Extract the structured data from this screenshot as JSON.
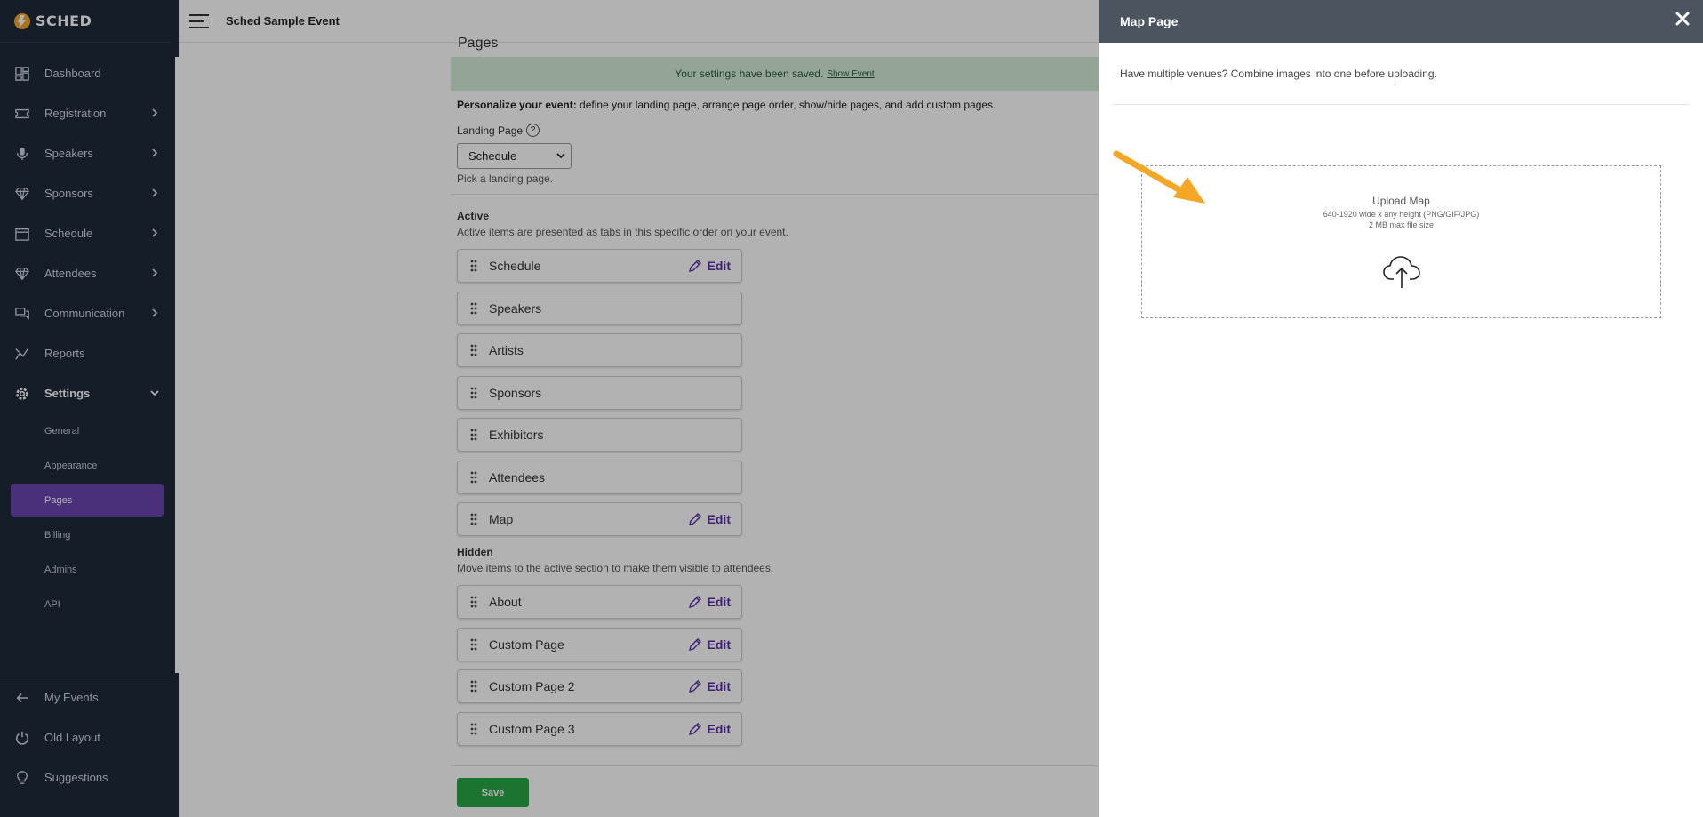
{
  "app": {
    "logo_text": "SCHED",
    "event_title": "Sched Sample Event"
  },
  "sidebar": {
    "items": [
      {
        "label": "Dashboard",
        "icon": "dashboard-icon",
        "has_chevron": false
      },
      {
        "label": "Registration",
        "icon": "ticket-icon",
        "has_chevron": true
      },
      {
        "label": "Speakers",
        "icon": "microphone-icon",
        "has_chevron": true
      },
      {
        "label": "Sponsors",
        "icon": "diamond-icon",
        "has_chevron": true
      },
      {
        "label": "Schedule",
        "icon": "calendar-icon",
        "has_chevron": true
      },
      {
        "label": "Attendees",
        "icon": "diamond-icon",
        "has_chevron": true
      },
      {
        "label": "Communication",
        "icon": "chat-icon",
        "has_chevron": true
      },
      {
        "label": "Reports",
        "icon": "chart-icon",
        "has_chevron": false
      },
      {
        "label": "Settings",
        "icon": "gear-icon",
        "has_chevron": true
      }
    ],
    "settings_sub": [
      "General",
      "Appearance",
      "Pages",
      "Billing",
      "Admins",
      "API"
    ],
    "bottom": [
      {
        "label": "My Events",
        "icon": "arrow-left-icon"
      },
      {
        "label": "Old Layout",
        "icon": "power-icon"
      },
      {
        "label": "Suggestions",
        "icon": "lightbulb-icon"
      }
    ]
  },
  "main": {
    "heading": "Pages",
    "alert": {
      "text": "Your settings have been saved.",
      "link": "Show Event"
    },
    "intro_bold": "Personalize your event:",
    "intro_text": " define your landing page, arrange page order, show/hide pages, and add custom pages.",
    "landing_label": "Landing Page",
    "landing_help": "?",
    "landing_value": "Schedule",
    "landing_hint": "Pick a landing page.",
    "active_title": "Active",
    "active_desc": "Active items are presented as tabs in this specific order on your event.",
    "active_items": [
      {
        "name": "Schedule",
        "editable": true
      },
      {
        "name": "Speakers",
        "editable": false
      },
      {
        "name": "Artists",
        "editable": false
      },
      {
        "name": "Sponsors",
        "editable": false
      },
      {
        "name": "Exhibitors",
        "editable": false
      },
      {
        "name": "Attendees",
        "editable": false
      },
      {
        "name": "Map",
        "editable": true
      }
    ],
    "hidden_title": "Hidden",
    "hidden_desc": "Move items to the active section to make them visible to attendees.",
    "hidden_items": [
      {
        "name": "About",
        "editable": true
      },
      {
        "name": "Custom Page",
        "editable": true
      },
      {
        "name": "Custom Page 2",
        "editable": true
      },
      {
        "name": "Custom Page 3",
        "editable": true
      }
    ],
    "edit_label": "Edit",
    "save_label": "Save"
  },
  "panel": {
    "title": "Map Page",
    "description": "Have multiple venues? Combine images into one before uploading.",
    "upload_title": "Upload Map",
    "upload_dims": "640-1920 wide x any height (PNG/GIF/JPG)",
    "upload_size": "2 MB max file size"
  },
  "colors": {
    "sidebar": "#1e2a3a",
    "accent": "#6a44b0",
    "edit": "#5b2fa8",
    "save": "#28a745",
    "panel_header": "#4a5560",
    "arrow": "#f5a623"
  }
}
